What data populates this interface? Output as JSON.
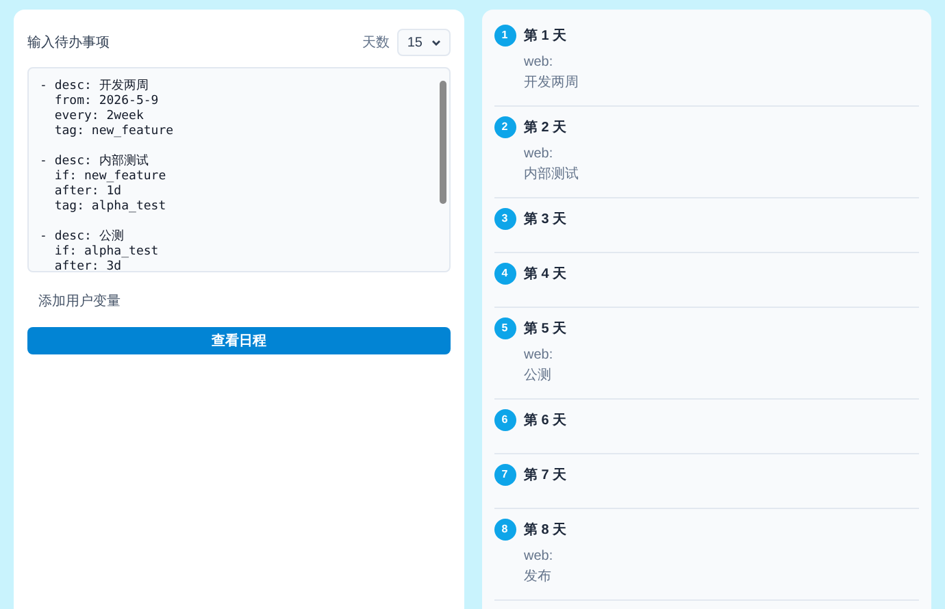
{
  "input_panel": {
    "title": "输入待办事项",
    "days_label": "天数",
    "days_select": {
      "value": "15"
    },
    "editor_blocks": [
      [
        "- desc: 开发两周",
        "  from: 2026-5-9",
        "  every: 2week",
        "  tag: new_feature"
      ],
      [
        "- desc: 内部测试",
        "  if: new_feature",
        "  after: 1d",
        "  tag: alpha_test"
      ],
      [
        "- desc: 公测",
        "  if: alpha_test",
        "  after: 3d"
      ]
    ],
    "add_variable_link": "添加用户变量",
    "submit_button": "查看日程"
  },
  "schedule": [
    {
      "number": "1",
      "title": "第 1 天",
      "tasks": [
        {
          "group": "web:",
          "desc": "开发两周"
        }
      ]
    },
    {
      "number": "2",
      "title": "第 2 天",
      "tasks": [
        {
          "group": "web:",
          "desc": "内部测试"
        }
      ]
    },
    {
      "number": "3",
      "title": "第 3 天"
    },
    {
      "number": "4",
      "title": "第 4 天"
    },
    {
      "number": "5",
      "title": "第 5 天",
      "tasks": [
        {
          "group": "web:",
          "desc": "公测"
        }
      ]
    },
    {
      "number": "6",
      "title": "第 6 天"
    },
    {
      "number": "7",
      "title": "第 7 天"
    },
    {
      "number": "8",
      "title": "第 8 天",
      "tasks": [
        {
          "group": "web:",
          "desc": "发布"
        }
      ]
    }
  ]
}
